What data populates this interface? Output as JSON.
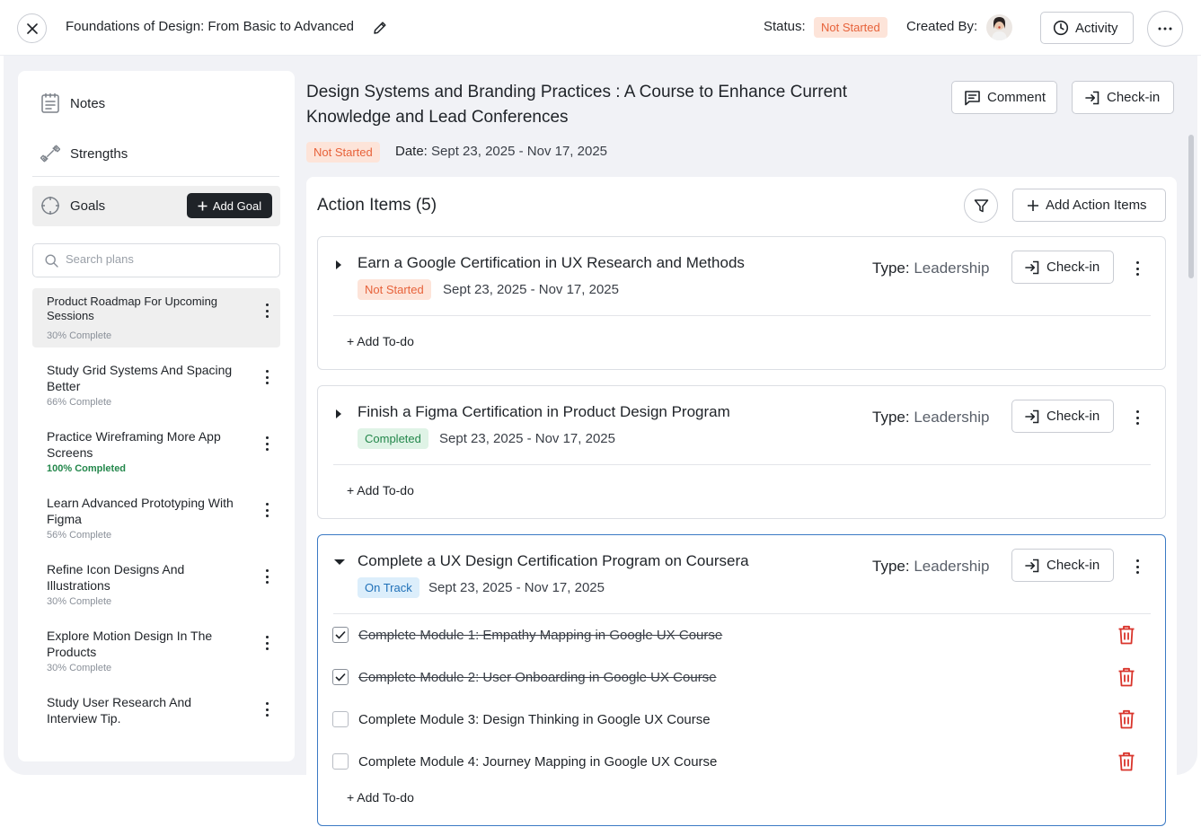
{
  "header": {
    "title": "Foundations of Design: From Basic to Advanced",
    "status_label": "Status:",
    "status_value": "Not Started",
    "created_by_label": "Created By:",
    "activity_label": "Activity"
  },
  "sidebar": {
    "nav": [
      {
        "label": "Notes",
        "icon": "notes-icon"
      },
      {
        "label": "Strengths",
        "icon": "dumbbell-icon"
      }
    ],
    "goals_label": "Goals",
    "add_goal_label": "Add Goal",
    "search_placeholder": "Search plans",
    "plans": [
      {
        "title": "Product Roadmap For Upcoming Sessions",
        "progress": "30% Complete",
        "active": true
      },
      {
        "title": "Study Grid Systems And Spacing Better",
        "progress": "66% Complete"
      },
      {
        "title": "Practice Wireframing More App Screens",
        "progress": "100% Completed",
        "complete": true
      },
      {
        "title": "Learn Advanced Prototyping With Figma",
        "progress": "56% Complete"
      },
      {
        "title": "Refine Icon Designs And Illustrations",
        "progress": "30% Complete"
      },
      {
        "title": "Explore Motion Design In The Products",
        "progress": "30% Complete"
      },
      {
        "title": "Study User Research And Interview Tip.",
        "progress": ""
      }
    ]
  },
  "main": {
    "title": "Design Systems and Branding Practices : A Course to Enhance Current Knowledge and Lead Conferences",
    "comment_label": "Comment",
    "checkin_label": "Check-in",
    "status": "Not Started",
    "date_label": "Date:",
    "date_value": "Sept 23, 2025 - Nov 17, 2025",
    "action_items_heading": "Action Items (5)",
    "add_action_items_label": "Add Action Items",
    "add_todo_label": "+ Add To-do",
    "type_label": "Type:",
    "items": [
      {
        "title": "Earn a Google Certification in UX Research and Methods",
        "status": "Not Started",
        "date": "Sept 23, 2025 - Nov 17, 2025",
        "type": "Leadership",
        "checkin": "Check-in"
      },
      {
        "title": "Finish a Figma Certification in Product Design Program",
        "status": "Completed",
        "date": "Sept 23, 2025 - Nov 17, 2025",
        "type": "Leadership",
        "checkin": "Check-in"
      },
      {
        "title": "Complete a UX Design Certification Program on Coursera",
        "status": "On Track",
        "date": "Sept 23, 2025 - Nov 17, 2025",
        "type": "Leadership",
        "checkin": "Check-in",
        "todos": [
          {
            "text": "Complete Module 1: Empathy Mapping in Google UX Course",
            "done": true
          },
          {
            "text": "Complete Module 2: User Onboarding in Google UX Course",
            "done": true
          },
          {
            "text": "Complete Module 3: Design Thinking in Google UX Course",
            "done": false
          },
          {
            "text": "Complete Module 4: Journey Mapping in Google UX Course",
            "done": false
          }
        ]
      }
    ]
  },
  "colors": {
    "not_started_bg": "#fde4d9",
    "not_started_fg": "#e7623a",
    "completed_bg": "#dff3e6",
    "completed_fg": "#23874b",
    "on_track_bg": "#dceefb",
    "on_track_fg": "#1f70b8",
    "danger": "#d9342b",
    "open_card_border": "#3b7ac4"
  }
}
